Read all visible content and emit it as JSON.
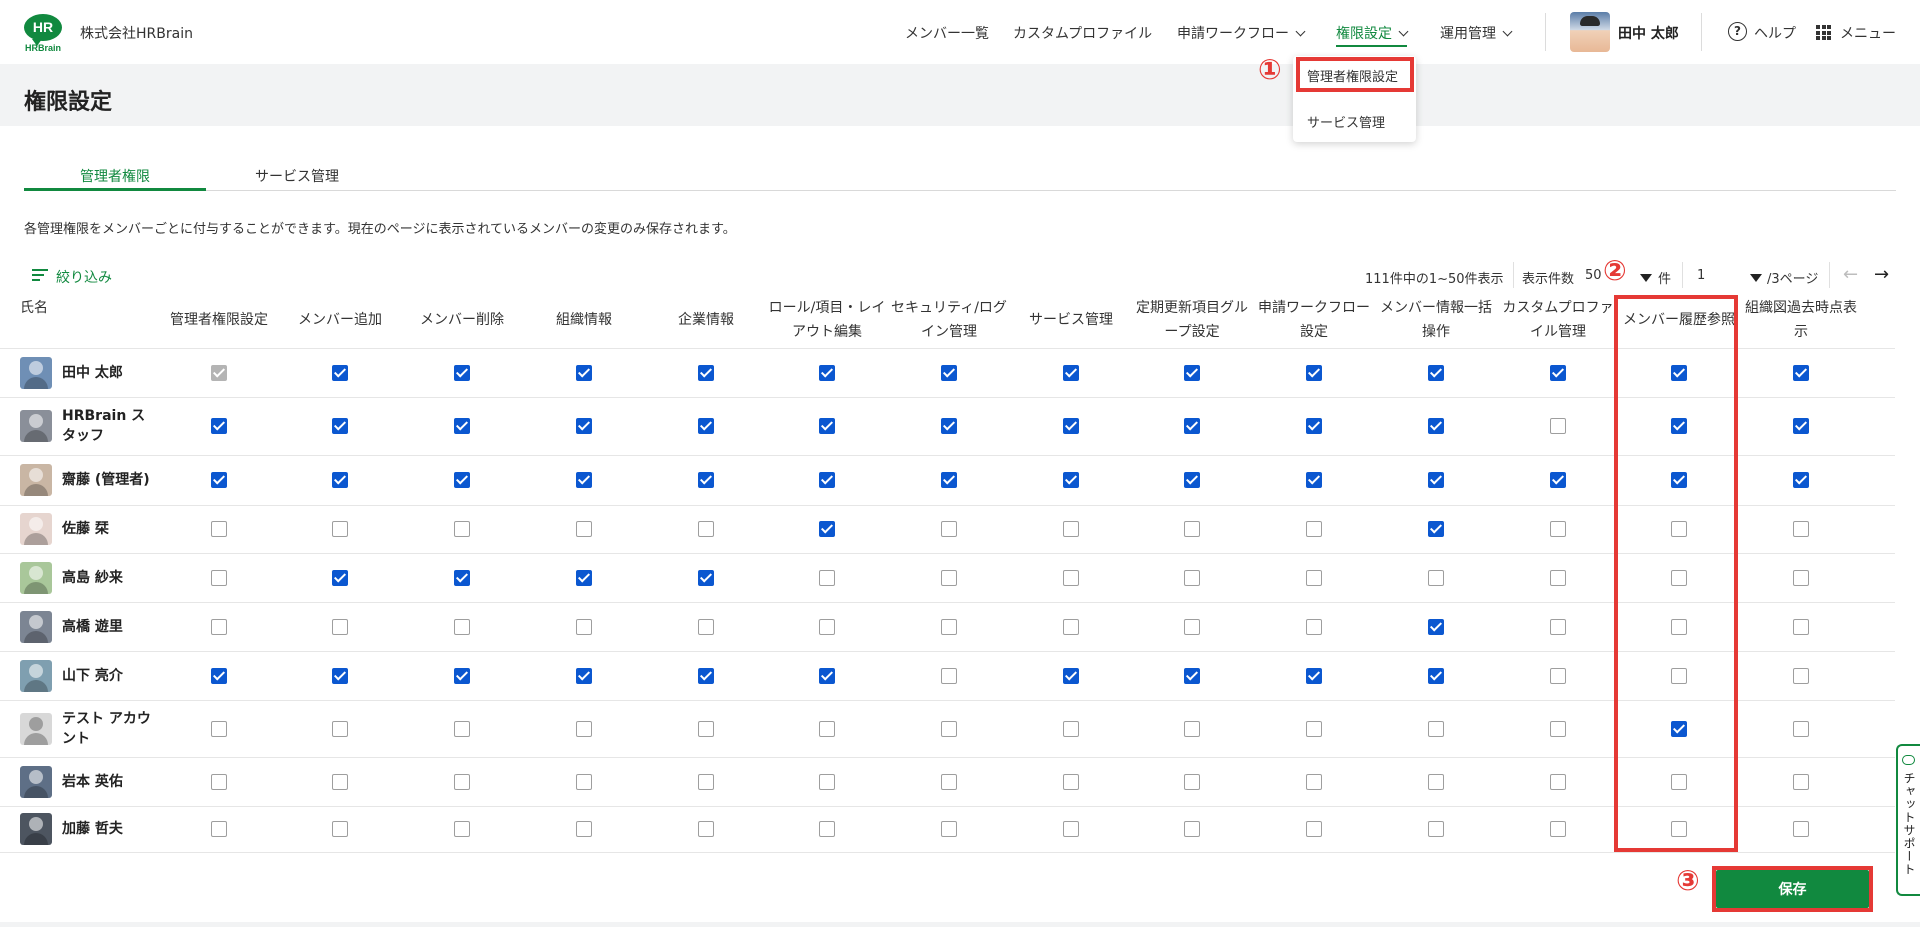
{
  "header": {
    "logo_text": "HR",
    "logo_word": "HRBrain",
    "company": "株式会社HRBrain",
    "nav": [
      {
        "label": "メンバー一覧",
        "dropdown": false,
        "active": false
      },
      {
        "label": "カスタムプロファイル",
        "dropdown": false,
        "active": false
      },
      {
        "label": "申請ワークフロー",
        "dropdown": true,
        "active": false
      },
      {
        "label": "権限設定",
        "dropdown": true,
        "active": true
      },
      {
        "label": "運用管理",
        "dropdown": true,
        "active": false
      }
    ],
    "user_name": "田中 太郎",
    "help_label": "ヘルプ",
    "help_glyph": "?",
    "menu_label": "メニュー",
    "accent_color": "#11893f"
  },
  "dropdown": {
    "items": [
      "管理者権限設定",
      "サービス管理"
    ]
  },
  "annotations": {
    "step1": "①",
    "step2": "②",
    "step3": "③",
    "highlight_color": "#e53935"
  },
  "page": {
    "title": "権限設定",
    "tabs": [
      "管理者権限",
      "サービス管理"
    ],
    "description": "各管理権限をメンバーごとに付与することができます。現在のページに表示されているメンバーの変更のみ保存されます。"
  },
  "toolbar": {
    "filter_label": "絞り込み",
    "range_text": "111件中の1~50件表示",
    "per_page_label": "表示件数",
    "per_page_value": "50",
    "per_page_unit": "件",
    "page_value": "1",
    "page_total": "/3ページ",
    "prev_arrow": "←",
    "next_arrow": "→"
  },
  "table": {
    "name_header": "氏名",
    "columns": [
      "管理者権限設定",
      "メンバー追加",
      "メンバー削除",
      "組織情報",
      "企業情報",
      "ロール/項目・レイアウト編集",
      "セキュリティ/ログイン管理",
      "サービス管理",
      "定期更新項目グループ設定",
      "申請ワークフロー設定",
      "メンバー情報一括操作",
      "カスタムプロファイル管理",
      "メンバー履歴参照",
      "組織図過去時点表示"
    ],
    "rows": [
      {
        "name": "田中 太郎",
        "avatar": "#6f8fb5",
        "checks": [
          2,
          1,
          1,
          1,
          1,
          1,
          1,
          1,
          1,
          1,
          1,
          1,
          1,
          1
        ]
      },
      {
        "name": "HRBrain スタッフ",
        "avatar": "#8a8f99",
        "checks": [
          1,
          1,
          1,
          1,
          1,
          1,
          1,
          1,
          1,
          1,
          1,
          0,
          1,
          1
        ]
      },
      {
        "name": "齋藤 (管理者)",
        "avatar": "#c9b6a4",
        "checks": [
          1,
          1,
          1,
          1,
          1,
          1,
          1,
          1,
          1,
          1,
          1,
          1,
          1,
          1
        ]
      },
      {
        "name": "佐藤 栞",
        "avatar": "#e6d5cf",
        "checks": [
          0,
          0,
          0,
          0,
          0,
          1,
          0,
          0,
          0,
          0,
          1,
          0,
          0,
          0
        ]
      },
      {
        "name": "高島 紗来",
        "avatar": "#a9c79a",
        "checks": [
          0,
          1,
          1,
          1,
          1,
          0,
          0,
          0,
          0,
          0,
          0,
          0,
          0,
          0
        ]
      },
      {
        "name": "高橋 遊里",
        "avatar": "#7c8593",
        "checks": [
          0,
          0,
          0,
          0,
          0,
          0,
          0,
          0,
          0,
          0,
          1,
          0,
          0,
          0
        ]
      },
      {
        "name": "山下 亮介",
        "avatar": "#7f9fb0",
        "checks": [
          1,
          1,
          1,
          1,
          1,
          1,
          0,
          1,
          1,
          1,
          1,
          0,
          0,
          0
        ]
      },
      {
        "name": "テスト アカウント",
        "avatar": "default",
        "checks": [
          0,
          0,
          0,
          0,
          0,
          0,
          0,
          0,
          0,
          0,
          0,
          0,
          1,
          0
        ]
      },
      {
        "name": "岩本 英佑",
        "avatar": "#5e6f86",
        "checks": [
          0,
          0,
          0,
          0,
          0,
          0,
          0,
          0,
          0,
          0,
          0,
          0,
          0,
          0
        ]
      },
      {
        "name": "加藤 哲夫",
        "avatar": "#4d5560",
        "checks": [
          0,
          0,
          0,
          0,
          0,
          0,
          0,
          0,
          0,
          0,
          0,
          0,
          0,
          0
        ]
      }
    ]
  },
  "save_label": "保存",
  "chat_support_label": "チャットサポート"
}
